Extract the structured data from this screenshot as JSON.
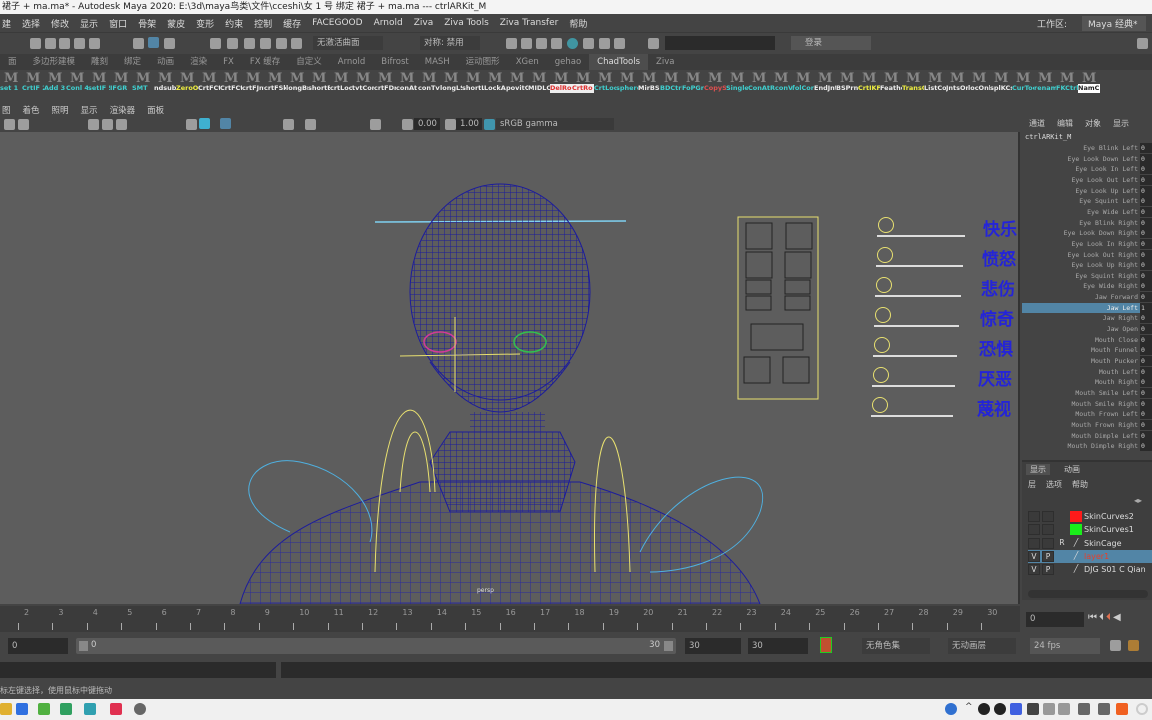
{
  "window": {
    "title": "裙子  + ma.ma* - Autodesk Maya 2020: E:\\3d\\maya鸟类\\文件\\cceshi\\女 1 号 绑定 裙子  + ma.ma   ---   ctrlARKit_M"
  },
  "menu": [
    "选择",
    "修改",
    "显示",
    "窗口",
    "骨架",
    "蒙皮",
    "变形",
    "约束",
    "控制",
    "缓存",
    "FACEGOOD",
    "Arnold",
    "Ziva",
    "Ziva Tools",
    "Ziva Transfer",
    "帮助"
  ],
  "menu_first": "建",
  "statusline": {
    "snap_field": "无激活曲面",
    "symmetry": "对称: 禁用",
    "login": "登录",
    "workspace_label": "工作区:",
    "workspace": "Maya 经典*"
  },
  "shelf_tabs": [
    "面",
    "多边形建模",
    "雕刻",
    "绑定",
    "动画",
    "渲染",
    "FX",
    "FX 缓存",
    "自定义",
    "Arnold",
    "Bifrost",
    "MASH",
    "运动图形",
    "XGen",
    "gehao",
    "ChadTools",
    "Ziva"
  ],
  "shelf_active": "ChadTools",
  "shelf_buttons": [
    {
      "label": "set 1",
      "color": "#3fd0d0"
    },
    {
      "label": "CrtIF 2",
      "color": "#3fd0d0"
    },
    {
      "label": "Add 3",
      "color": "#3fd0d0"
    },
    {
      "label": "Conl 4",
      "color": "#3fd0d0"
    },
    {
      "label": "setIF 5",
      "color": "#3fd0d0"
    },
    {
      "label": "IFGR",
      "color": "#3fd0d0"
    },
    {
      "label": "SMT",
      "color": "#3fd0d0"
    },
    {
      "label": "ndsub",
      "color": "#eeeeee"
    },
    {
      "label": "ZeroO",
      "color": "#f0f040"
    },
    {
      "label": "CrtFCt",
      "color": "#eeeeee"
    },
    {
      "label": "CrtFCt",
      "color": "#eeeeee"
    },
    {
      "label": "crtFJnt",
      "color": "#eeeeee"
    },
    {
      "label": "crtFSk",
      "color": "#eeeeee"
    },
    {
      "label": "longBr",
      "color": "#eeeeee"
    },
    {
      "label": "shortB",
      "color": "#eeeeee"
    },
    {
      "label": "crtLoc",
      "color": "#eeeeee"
    },
    {
      "label": "tvtCon",
      "color": "#eeeeee"
    },
    {
      "label": "crtFDr",
      "color": "#eeeeee"
    },
    {
      "label": "conAt",
      "color": "#eeeeee"
    },
    {
      "label": "conTvt",
      "color": "#eeeeee"
    },
    {
      "label": "longLS",
      "color": "#eeeeee"
    },
    {
      "label": "shortL",
      "color": "#eeeeee"
    },
    {
      "label": "LockA",
      "color": "#eeeeee"
    },
    {
      "label": "povitC",
      "color": "#eeeeee"
    },
    {
      "label": "MIDLC",
      "color": "#eeeeee"
    },
    {
      "label": "DelRo",
      "color": "#e03030"
    },
    {
      "label": "CrtRo",
      "color": "#e03030"
    },
    {
      "label": "CrtLoc",
      "color": "#3fd0d0"
    },
    {
      "label": "sphere",
      "color": "#3fd0d0"
    },
    {
      "label": "MirBS",
      "color": "#eeeeee"
    },
    {
      "label": "BDCtrl",
      "color": "#3fd0d0"
    },
    {
      "label": "FoPGr",
      "color": "#3fd0d0"
    },
    {
      "label": "CopyS",
      "color": "#e05050"
    },
    {
      "label": "Single",
      "color": "#3fd0d0"
    },
    {
      "label": "ConAt",
      "color": "#3fd0d0"
    },
    {
      "label": "RconV",
      "color": "#3fd0d0"
    },
    {
      "label": "folCor",
      "color": "#3fd0d0"
    },
    {
      "label": "EndJnt",
      "color": "#eeeeee"
    },
    {
      "label": "BSPrnl",
      "color": "#eeeeee"
    },
    {
      "label": "CrtIKF",
      "color": "#f0f040"
    },
    {
      "label": "Feathe",
      "color": "#eeeeee"
    },
    {
      "label": "TransC",
      "color": "#f0f040"
    },
    {
      "label": "ListCo",
      "color": "#eeeeee"
    },
    {
      "label": "JntsOr",
      "color": "#eeeeee"
    },
    {
      "label": "locOnl",
      "color": "#eeeeee"
    },
    {
      "label": "splKCs",
      "color": "#eeeeee"
    },
    {
      "label": "CurToc",
      "color": "#3fd0d0"
    },
    {
      "label": "renam",
      "color": "#3fd0d0"
    },
    {
      "label": "FKCtrl",
      "color": "#3fd0d0"
    },
    {
      "label": "NamC",
      "color": "#222222"
    }
  ],
  "viewport": {
    "menu": [
      "图",
      "着色",
      "照明",
      "显示",
      "渲染器",
      "面板"
    ],
    "exposure": "0.00",
    "gamma": "1.00",
    "colorspace": "sRGB gamma",
    "camera": "persp",
    "emotions": [
      "快乐",
      "愤怒",
      "悲伤",
      "惊奇",
      "恐惧",
      "厌恶",
      "蔑视"
    ]
  },
  "channel_box": {
    "menu": [
      "通道",
      "编辑",
      "对象",
      "显示"
    ],
    "node": "ctrlARKit_M",
    "attributes": [
      {
        "name": "Eye Blink Left",
        "value": "0"
      },
      {
        "name": "Eye Look Down Left",
        "value": "0"
      },
      {
        "name": "Eye Look In Left",
        "value": "0"
      },
      {
        "name": "Eye Look Out Left",
        "value": "0"
      },
      {
        "name": "Eye Look Up Left",
        "value": "0"
      },
      {
        "name": "Eye Squint Left",
        "value": "0"
      },
      {
        "name": "Eye Wide Left",
        "value": "0"
      },
      {
        "name": "Eye Blink Right",
        "value": "0"
      },
      {
        "name": "Eye Look Down Right",
        "value": "0"
      },
      {
        "name": "Eye Look In Right",
        "value": "0"
      },
      {
        "name": "Eye Look Out Right",
        "value": "0"
      },
      {
        "name": "Eye Look Up Right",
        "value": "0"
      },
      {
        "name": "Eye Squint Right",
        "value": "0"
      },
      {
        "name": "Eye Wide Right",
        "value": "0"
      },
      {
        "name": "Jaw Forward",
        "value": "0"
      },
      {
        "name": "Jaw Left",
        "value": "1",
        "selected": true
      },
      {
        "name": "Jaw Right",
        "value": "0"
      },
      {
        "name": "Jaw Open",
        "value": "0"
      },
      {
        "name": "Mouth Close",
        "value": "0"
      },
      {
        "name": "Mouth Funnel",
        "value": "0"
      },
      {
        "name": "Mouth Pucker",
        "value": "0"
      },
      {
        "name": "Mouth Left",
        "value": "0"
      },
      {
        "name": "Mouth Right",
        "value": "0"
      },
      {
        "name": "Mouth Smile Left",
        "value": "0"
      },
      {
        "name": "Mouth Smile Right",
        "value": "0"
      },
      {
        "name": "Mouth Frown Left",
        "value": "0"
      },
      {
        "name": "Mouth Frown Right",
        "value": "0"
      },
      {
        "name": "Mouth Dimple Left",
        "value": "0"
      },
      {
        "name": "Mouth Dimple Right",
        "value": "0"
      }
    ]
  },
  "layer_editor": {
    "tabs": [
      "显示",
      "动画"
    ],
    "menu": [
      "层",
      "选项",
      "帮助"
    ],
    "layers": [
      {
        "name": "SkinCurves2",
        "v": "",
        "p": "",
        "r": "",
        "color": "#ff1a1a"
      },
      {
        "name": "SkinCurves1",
        "v": "",
        "p": "",
        "r": "",
        "color": "#1aee1a"
      },
      {
        "name": "SkinCage",
        "v": "",
        "p": "",
        "r": "R",
        "color": ""
      },
      {
        "name": "layer1",
        "v": "V",
        "p": "P",
        "r": "",
        "color": "",
        "selected": true
      },
      {
        "name": "DJG S01 C Qian",
        "v": "V",
        "p": "P",
        "r": "",
        "color": ""
      }
    ]
  },
  "time_slider": {
    "ticks": [
      "2",
      "3",
      "4",
      "5",
      "6",
      "7",
      "8",
      "9",
      "10",
      "11",
      "12",
      "13",
      "14",
      "15",
      "16",
      "17",
      "18",
      "19",
      "20",
      "21",
      "22",
      "23",
      "24",
      "25",
      "26",
      "27",
      "28",
      "29",
      "30"
    ],
    "current_frame": "0"
  },
  "range": {
    "start": "0",
    "range_start": "0",
    "range_end": "30",
    "end": "30",
    "anim_end": "30",
    "character_set": "无角色集",
    "anim_layer": "无动画层",
    "fps": "24 fps"
  },
  "help_line": "标左键选择，使用鼠标中键拖动",
  "colors": {
    "viewport_bg": "#5d5d5d",
    "mesh": "#1c1c9c",
    "selection": "#5285a6",
    "controls": "#e8e070"
  }
}
